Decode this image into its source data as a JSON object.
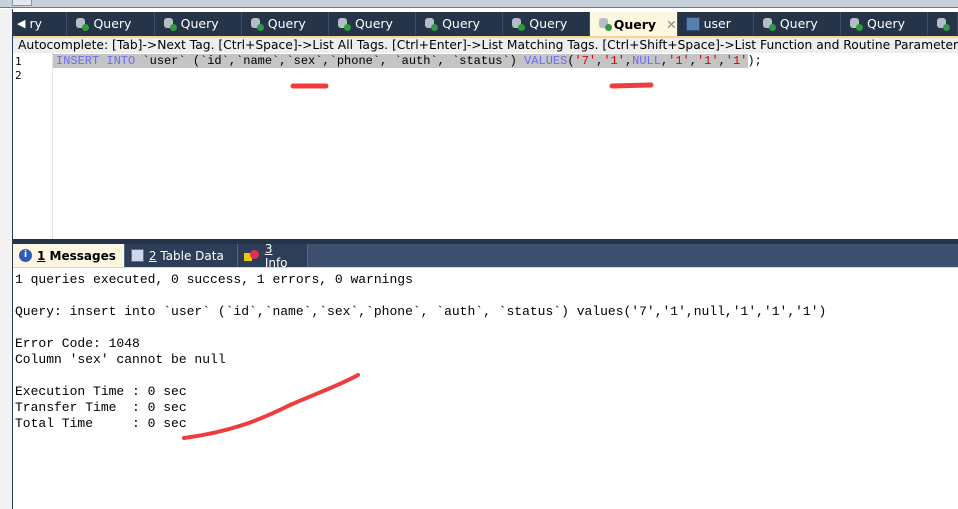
{
  "tabs": [
    {
      "label": "ry",
      "icon": "scroll-left-icon"
    },
    {
      "label": "Query",
      "icon": "query-icon"
    },
    {
      "label": "Query",
      "icon": "query-icon"
    },
    {
      "label": "Query",
      "icon": "query-icon"
    },
    {
      "label": "Query",
      "icon": "query-icon"
    },
    {
      "label": "Query",
      "icon": "query-icon"
    },
    {
      "label": "Query",
      "icon": "query-icon"
    },
    {
      "label": "Query",
      "icon": "query-icon",
      "active": true,
      "close": "✕"
    },
    {
      "label": "user",
      "icon": "table-icon"
    },
    {
      "label": "Query",
      "icon": "query-icon"
    },
    {
      "label": "Query",
      "icon": "query-icon"
    },
    {
      "label": "",
      "icon": "query-icon"
    }
  ],
  "autocomplete": "Autocomplete: [Tab]->Next Tag. [Ctrl+Space]->List All Tags. [Ctrl+Enter]->List Matching Tags. [Ctrl+Shift+Space]->List Function and Routine Parameters.",
  "editor": {
    "line_numbers": [
      "1",
      "2"
    ],
    "code": {
      "kw1": "INSERT INTO",
      "t1": " `user` (`id`,`name`,`sex`,`phone`, `auth`, `status`) ",
      "kw2": "VALUES",
      "p1": "(",
      "s1": "'7'",
      "c1": ",",
      "s2": "'1'",
      "c2": ",",
      "n1": "NULL",
      "c3": ",",
      "s3": "'1'",
      "c4": ",",
      "s4": "'1'",
      "c5": ",",
      "s5": "'1'",
      "end": ");"
    }
  },
  "result_tabs": [
    {
      "num": "1",
      "label": " Messages",
      "icon": "info-icon",
      "active": true
    },
    {
      "num": "2",
      "label": " Table Data",
      "icon": "table-icon"
    },
    {
      "num": "3",
      "label": " Info",
      "icon": "chart-icon"
    }
  ],
  "messages": [
    "1 queries executed, 0 success, 1 errors, 0 warnings",
    "",
    "Query: insert into `user` (`id`,`name`,`sex`,`phone`, `auth`, `status`) values('7','1',null,'1','1','1')",
    "",
    "Error Code: 1048",
    "Column 'sex' cannot be null",
    "",
    "Execution Time : 0 sec",
    "Transfer Time  : 0 sec",
    "Total Time     : 0 sec"
  ],
  "colors": {
    "annotation": "#f03c3c",
    "tabbar": "#26344a",
    "active_tab": "#fdf6e0"
  }
}
